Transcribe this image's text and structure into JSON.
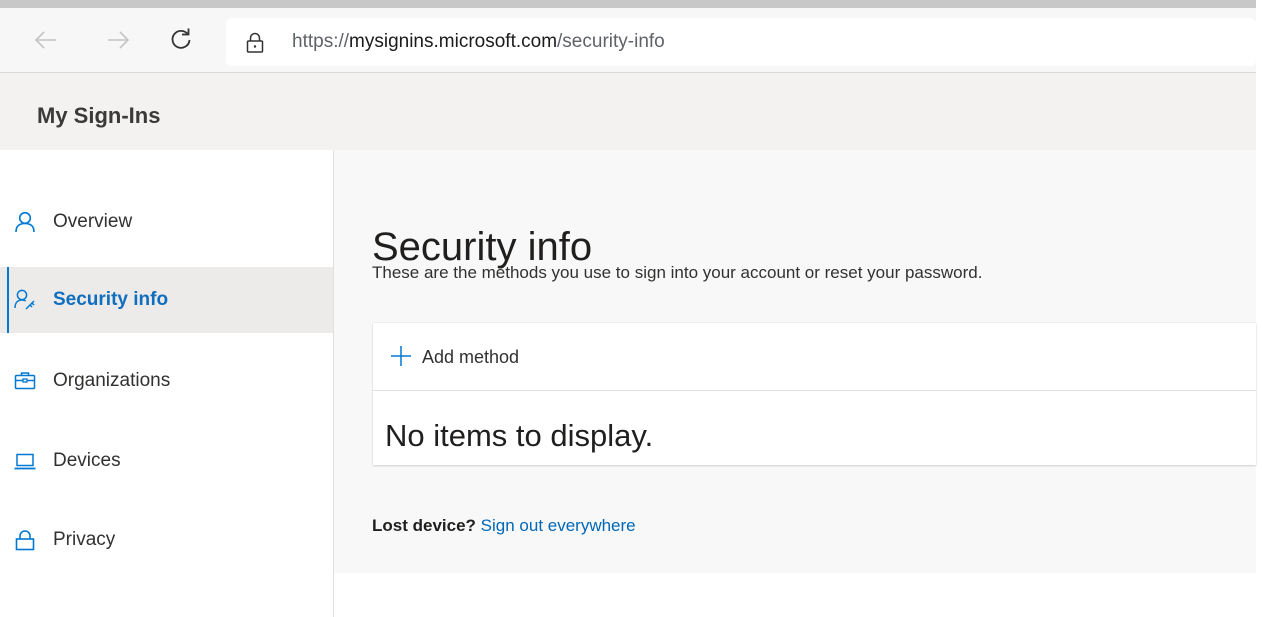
{
  "browser": {
    "url_prefix": "https://",
    "url_domain": "mysignins.microsoft.com",
    "url_path": "/security-info"
  },
  "app": {
    "title": "My Sign-Ins"
  },
  "sidebar": {
    "items": [
      {
        "label": "Overview",
        "icon": "person-icon"
      },
      {
        "label": "Security info",
        "icon": "person-key-icon",
        "active": true
      },
      {
        "label": "Organizations",
        "icon": "briefcase-icon"
      },
      {
        "label": "Devices",
        "icon": "laptop-icon"
      },
      {
        "label": "Privacy",
        "icon": "lock-icon"
      }
    ]
  },
  "main": {
    "title": "Security info",
    "subtitle": "These are the methods you use to sign into your account or reset your password.",
    "add_method_label": "Add method",
    "empty_text": "No items to display.",
    "lost_device_label": "Lost device?",
    "sign_out_link": "Sign out everywhere"
  },
  "colors": {
    "accent": "#0078d4",
    "link": "#0067b8",
    "header_bg": "#f3f2f1",
    "active_bg": "#edebe9"
  }
}
